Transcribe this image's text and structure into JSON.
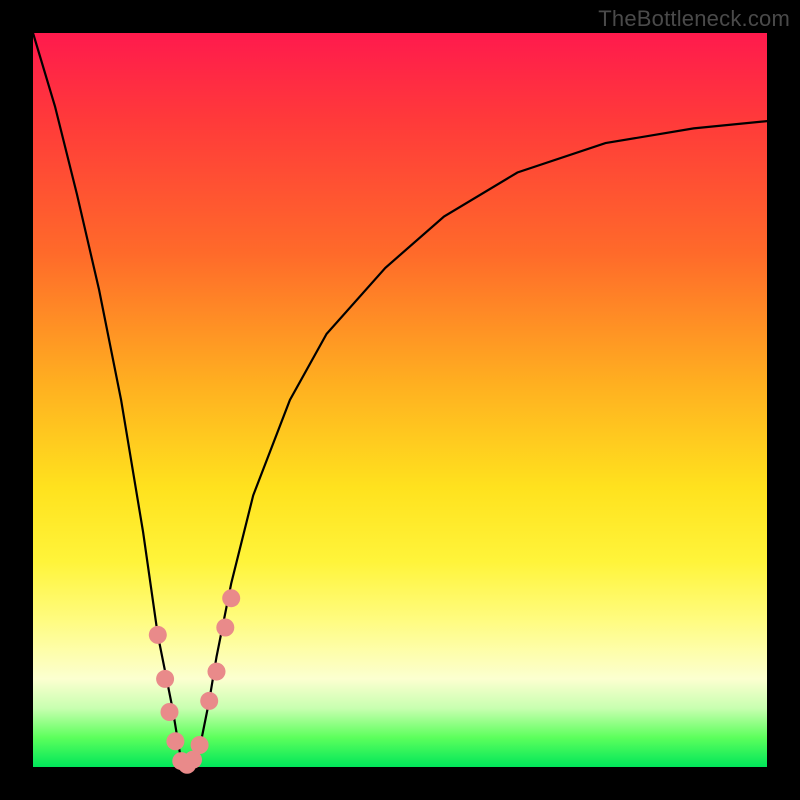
{
  "watermark": "TheBottleneck.com",
  "chart_data": {
    "type": "line",
    "title": "",
    "xlabel": "",
    "ylabel": "",
    "xlim": [
      0,
      100
    ],
    "ylim": [
      0,
      100
    ],
    "series": [
      {
        "name": "bottleneck-curve",
        "x": [
          0,
          3,
          6,
          9,
          12,
          15,
          17,
          19,
          20,
          21,
          22,
          23,
          24,
          25,
          27,
          30,
          35,
          40,
          48,
          56,
          66,
          78,
          90,
          100
        ],
        "values": [
          100,
          90,
          78,
          65,
          50,
          32,
          18,
          8,
          2,
          0,
          1,
          4,
          9,
          15,
          25,
          37,
          50,
          59,
          68,
          75,
          81,
          85,
          87,
          88
        ]
      }
    ],
    "markers": {
      "name": "highlighted-points",
      "color": "#e98a8a",
      "points": [
        {
          "x": 17.0,
          "y": 18.0
        },
        {
          "x": 18.0,
          "y": 12.0
        },
        {
          "x": 18.6,
          "y": 7.5
        },
        {
          "x": 19.4,
          "y": 3.5
        },
        {
          "x": 20.2,
          "y": 0.8
        },
        {
          "x": 21.0,
          "y": 0.3
        },
        {
          "x": 21.8,
          "y": 1.0
        },
        {
          "x": 22.7,
          "y": 3.0
        },
        {
          "x": 24.0,
          "y": 9.0
        },
        {
          "x": 25.0,
          "y": 13.0
        },
        {
          "x": 26.2,
          "y": 19.0
        },
        {
          "x": 27.0,
          "y": 23.0
        }
      ]
    },
    "background": {
      "type": "vertical-gradient",
      "description": "red (high bottleneck) at top → green (no bottleneck) at bottom",
      "stops": [
        {
          "pos": 0.0,
          "color": "#ff1a4d"
        },
        {
          "pos": 0.3,
          "color": "#ff6a2a"
        },
        {
          "pos": 0.62,
          "color": "#ffe21e"
        },
        {
          "pos": 0.88,
          "color": "#fcffd0"
        },
        {
          "pos": 1.0,
          "color": "#00e65a"
        }
      ]
    }
  }
}
